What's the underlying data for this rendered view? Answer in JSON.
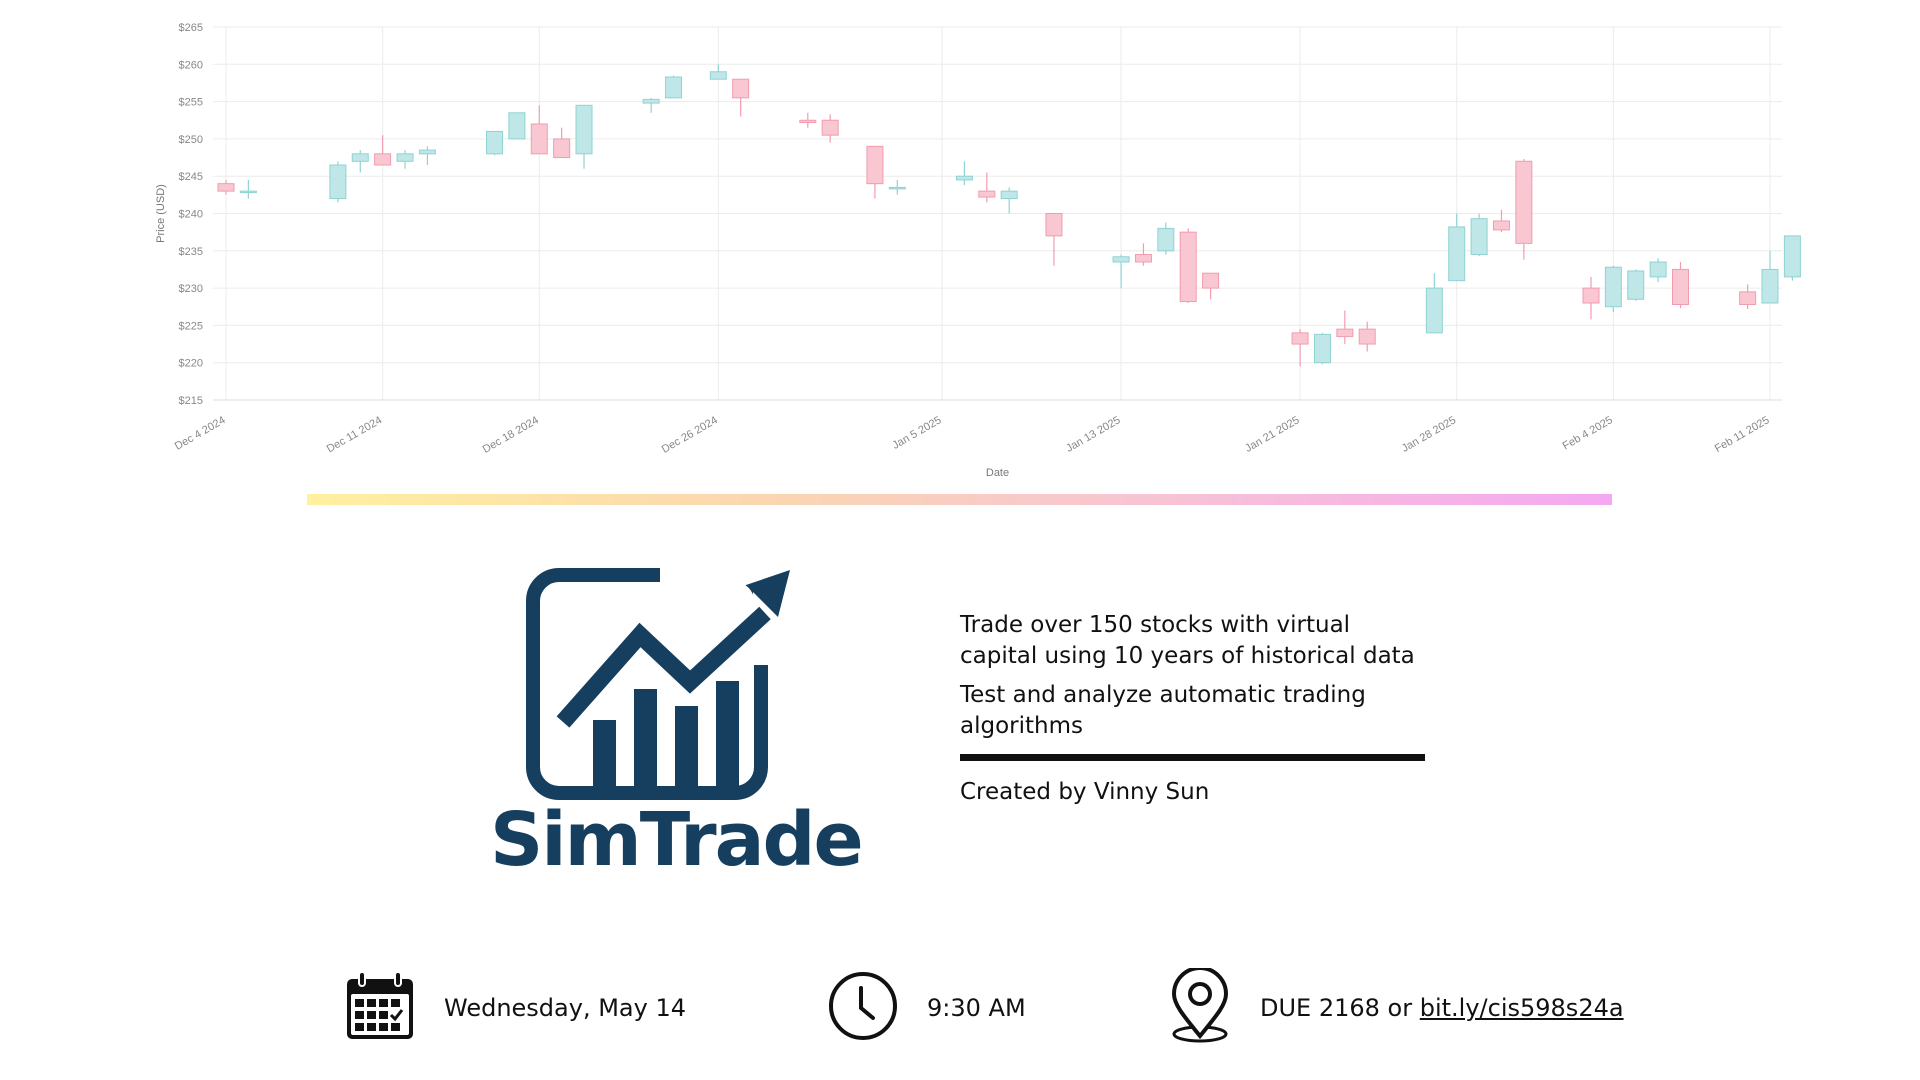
{
  "chart_data": {
    "type": "candlestick",
    "xlabel": "Date",
    "ylabel": "Price (USD)",
    "ylim": [
      215,
      265
    ],
    "yticks": [
      "$215",
      "$220",
      "$225",
      "$230",
      "$235",
      "$240",
      "$245",
      "$250",
      "$255",
      "$260",
      "$265"
    ],
    "xticks": [
      "Dec 4 2024",
      "Dec 11 2024",
      "Dec 18 2024",
      "Dec 26 2024",
      "Jan 5 2025",
      "Jan 13 2025",
      "Jan 21 2025",
      "Jan 28 2025",
      "Feb 4 2025",
      "Feb 11 2025"
    ],
    "grid": true,
    "colors": {
      "up": "#bfe7e7",
      "up_stroke": "#8fd3d3",
      "down": "#f9c7d2",
      "down_stroke": "#f29cb0"
    },
    "candles": [
      {
        "date": "2024-12-04",
        "open": 244,
        "high": 244.5,
        "low": 242.5,
        "close": 243
      },
      {
        "date": "2024-12-05",
        "open": 243,
        "high": 244.5,
        "low": 242,
        "close": 243
      },
      {
        "date": "2024-12-09",
        "open": 242,
        "high": 247,
        "low": 241.5,
        "close": 246.5
      },
      {
        "date": "2024-12-10",
        "open": 247,
        "high": 248.5,
        "low": 245.5,
        "close": 248
      },
      {
        "date": "2024-12-11",
        "open": 248,
        "high": 250.5,
        "low": 246.5,
        "close": 246.5
      },
      {
        "date": "2024-12-12",
        "open": 247,
        "high": 248.5,
        "low": 246,
        "close": 248
      },
      {
        "date": "2024-12-13",
        "open": 248,
        "high": 249,
        "low": 246.5,
        "close": 248.5
      },
      {
        "date": "2024-12-16",
        "open": 248,
        "high": 251,
        "low": 247.8,
        "close": 251
      },
      {
        "date": "2024-12-17",
        "open": 250,
        "high": 253.5,
        "low": 250,
        "close": 253.5
      },
      {
        "date": "2024-12-18",
        "open": 252,
        "high": 254.5,
        "low": 248,
        "close": 248
      },
      {
        "date": "2024-12-19",
        "open": 250,
        "high": 251.5,
        "low": 247.5,
        "close": 247.5
      },
      {
        "date": "2024-12-20",
        "open": 248,
        "high": 254.5,
        "low": 246,
        "close": 254.5
      },
      {
        "date": "2024-12-23",
        "open": 254.8,
        "high": 255.5,
        "low": 253.5,
        "close": 255.3
      },
      {
        "date": "2024-12-24",
        "open": 255.5,
        "high": 258.5,
        "low": 255.5,
        "close": 258.3
      },
      {
        "date": "2024-12-26",
        "open": 258,
        "high": 260,
        "low": 258,
        "close": 259
      },
      {
        "date": "2024-12-27",
        "open": 258,
        "high": 258,
        "low": 253,
        "close": 255.5
      },
      {
        "date": "2024-12-30",
        "open": 252.5,
        "high": 253.5,
        "low": 251.5,
        "close": 252.2
      },
      {
        "date": "2024-12-31",
        "open": 252.5,
        "high": 253.3,
        "low": 249.5,
        "close": 250.5
      },
      {
        "date": "2025-01-02",
        "open": 249,
        "high": 249,
        "low": 242,
        "close": 244
      },
      {
        "date": "2025-01-03",
        "open": 243.5,
        "high": 244.5,
        "low": 242.5,
        "close": 243.5
      },
      {
        "date": "2025-01-06",
        "open": 244.5,
        "high": 247,
        "low": 243.8,
        "close": 245
      },
      {
        "date": "2025-01-07",
        "open": 243,
        "high": 245.5,
        "low": 241.5,
        "close": 242.2
      },
      {
        "date": "2025-01-08",
        "open": 242,
        "high": 243.5,
        "low": 240,
        "close": 243
      },
      {
        "date": "2025-01-10",
        "open": 240,
        "high": 240,
        "low": 233,
        "close": 237
      },
      {
        "date": "2025-01-13",
        "open": 233.5,
        "high": 234.5,
        "low": 230,
        "close": 234.2
      },
      {
        "date": "2025-01-14",
        "open": 234.5,
        "high": 236,
        "low": 233,
        "close": 233.5
      },
      {
        "date": "2025-01-15",
        "open": 235,
        "high": 238.8,
        "low": 234.5,
        "close": 238
      },
      {
        "date": "2025-01-16",
        "open": 237.5,
        "high": 238,
        "low": 228,
        "close": 228.2
      },
      {
        "date": "2025-01-17",
        "open": 232,
        "high": 232,
        "low": 228.5,
        "close": 230
      },
      {
        "date": "2025-01-21",
        "open": 224,
        "high": 224.5,
        "low": 219.5,
        "close": 222.5
      },
      {
        "date": "2025-01-22",
        "open": 220,
        "high": 224,
        "low": 219.8,
        "close": 223.8
      },
      {
        "date": "2025-01-23",
        "open": 224.5,
        "high": 227,
        "low": 222.5,
        "close": 223.5
      },
      {
        "date": "2025-01-24",
        "open": 224.5,
        "high": 225.5,
        "low": 221.5,
        "close": 222.5
      },
      {
        "date": "2025-01-27",
        "open": 224,
        "high": 232,
        "low": 224,
        "close": 230
      },
      {
        "date": "2025-01-28",
        "open": 231,
        "high": 240,
        "low": 231,
        "close": 238.2
      },
      {
        "date": "2025-01-29",
        "open": 234.5,
        "high": 240,
        "low": 234.3,
        "close": 239.3
      },
      {
        "date": "2025-01-30",
        "open": 239,
        "high": 240.5,
        "low": 237.5,
        "close": 237.8
      },
      {
        "date": "2025-01-31",
        "open": 247,
        "high": 247.3,
        "low": 233.8,
        "close": 236
      },
      {
        "date": "2025-02-03",
        "open": 230,
        "high": 231.5,
        "low": 225.8,
        "close": 228
      },
      {
        "date": "2025-02-04",
        "open": 227.5,
        "high": 233,
        "low": 226.8,
        "close": 232.8
      },
      {
        "date": "2025-02-05",
        "open": 228.5,
        "high": 232.5,
        "low": 228.3,
        "close": 232.3
      },
      {
        "date": "2025-02-06",
        "open": 231.5,
        "high": 234,
        "low": 230.8,
        "close": 233.5
      },
      {
        "date": "2025-02-07",
        "open": 232.5,
        "high": 233.5,
        "low": 227.3,
        "close": 227.8
      },
      {
        "date": "2025-02-10",
        "open": 229.5,
        "high": 230.5,
        "low": 227.2,
        "close": 227.8
      },
      {
        "date": "2025-02-11",
        "open": 228,
        "high": 235,
        "low": 228,
        "close": 232.5
      },
      {
        "date": "2025-02-12",
        "open": 231.5,
        "high": 237,
        "low": 231,
        "close": 237
      }
    ]
  },
  "logo": {
    "name": "SimTrade",
    "color": "#163f5f"
  },
  "info": {
    "line1": "Trade over 150 stocks with virtual capital using 10 years of historical data",
    "line2": "Test and analyze automatic trading algorithms",
    "credit": "Created by Vinny Sun"
  },
  "event": {
    "date": "Wednesday, May 14",
    "time": "9:30 AM",
    "location_prefix": "DUE 2168 or ",
    "location_link": "bit.ly/cis598s24a",
    "icons": [
      "calendar-icon",
      "clock-icon",
      "location-pin-icon"
    ]
  }
}
